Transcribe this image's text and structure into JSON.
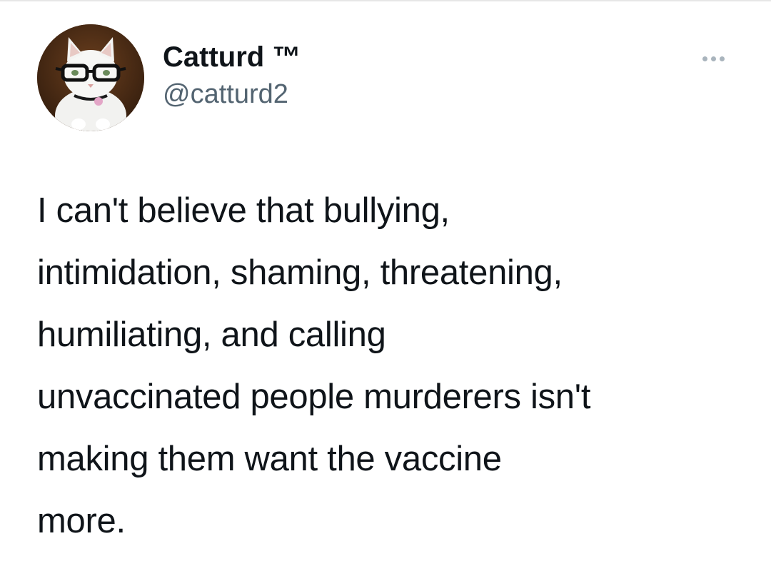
{
  "tweet": {
    "author": {
      "display_name": "Catturd ™",
      "handle": "@catturd2",
      "avatar_icon": "cat-with-glasses-avatar"
    },
    "menu_icon": "more-options-icon",
    "text": "I can't believe that bullying,\nintimidation, shaming, threatening,\nhumiliating, and calling\nunvaccinated people murderers isn't\nmaking them want the vaccine\nmore."
  },
  "colors": {
    "text_primary": "#0f1419",
    "text_secondary": "#536471",
    "menu_dots": "#a9b4bd",
    "background": "#ffffff"
  }
}
